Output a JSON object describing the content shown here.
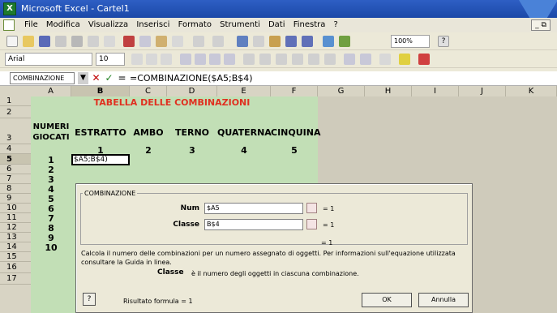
{
  "window": {
    "title": "Microsoft Excel - Cartel1"
  },
  "menu": [
    "File",
    "Modifica",
    "Visualizza",
    "Inserisci",
    "Formato",
    "Strumenti",
    "Dati",
    "Finestra",
    "?"
  ],
  "toolbar": {
    "font": "Arial",
    "size": "10",
    "zoom": "100%"
  },
  "formula_bar": {
    "name_box": "COMBINAZIONE",
    "cancel": "✕",
    "enter": "✓",
    "fx": "=",
    "formula": "=COMBINAZIONE($A5;B$4)"
  },
  "columns": [
    "A",
    "B",
    "C",
    "D",
    "E",
    "F",
    "G",
    "H",
    "I",
    "J",
    "K"
  ],
  "rows": [
    "1",
    "2",
    "3",
    "4",
    "5",
    "6",
    "7",
    "8",
    "9",
    "10",
    "11",
    "12",
    "13",
    "14",
    "15",
    "16",
    "17"
  ],
  "sheet": {
    "title": "TABELLA DELLE COMBINAZIONI",
    "header_numeri": "NUMERI GIOCATI",
    "headers": [
      "ESTRATTO",
      "AMBO",
      "TERNO",
      "QUATERNA",
      "CINQUINA"
    ],
    "header_values": [
      "1",
      "2",
      "3",
      "4",
      "5"
    ],
    "numbers": [
      "1",
      "2",
      "3",
      "4",
      "5",
      "6",
      "7",
      "8",
      "9",
      "10"
    ],
    "active_cell": "$A5;B$4)"
  },
  "dialog": {
    "title": "COMBINAZIONE",
    "num_label": "Num",
    "num_value": "$A5",
    "num_result": "= 1",
    "classe_label": "Classe",
    "classe_value": "B$4",
    "classe_result": "= 1",
    "total_result": "= 1",
    "description": "Calcola il numero delle combinazioni per un numero assegnato di oggetti. Per informazioni sull'equazione utilizzata consultare la Guida in linea.",
    "arg_name": "Classe",
    "arg_desc": "è il numero degli oggetti in ciascuna combinazione.",
    "help": "?",
    "result_formula": "Risultato formula = 1",
    "ok": "OK",
    "cancel": "Annulla"
  }
}
